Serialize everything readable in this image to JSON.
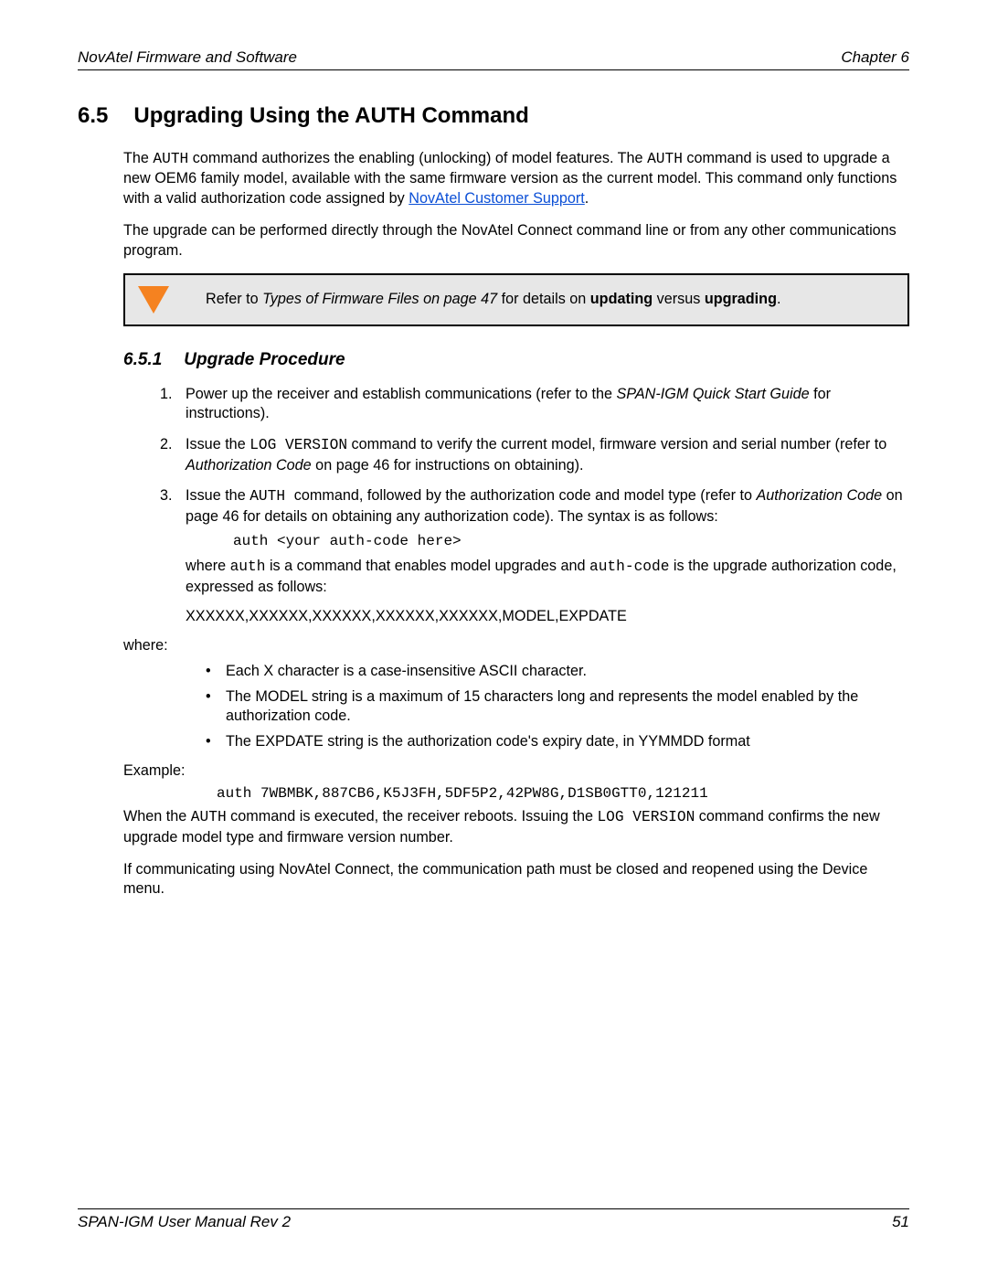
{
  "header": {
    "left": "NovAtel Firmware and Software",
    "right": "Chapter 6"
  },
  "section": {
    "number": "6.5",
    "title": "Upgrading Using the AUTH Command"
  },
  "intro": {
    "p1_a": "The ",
    "p1_code1": "AUTH",
    "p1_b": " command authorizes the enabling (unlocking) of model features. The ",
    "p1_code2": "AUTH",
    "p1_c": " command is used to upgrade a new OEM6 family model, available with the same firmware version as the current model. This command only functions with a valid authorization code assigned by ",
    "p1_link": "NovAtel Customer Support",
    "p1_d": ".",
    "p2": "The upgrade can be performed directly through the NovAtel Connect command line or from any other communications program."
  },
  "note": {
    "prefix": "Refer to ",
    "italic_ref": "Types of Firmware Files on page 47",
    "mid": " for details on ",
    "bold1": "updating",
    "vs": " versus ",
    "bold2": "upgrading",
    "suffix": "."
  },
  "subsection": {
    "number": "6.5.1",
    "title": "Upgrade Procedure"
  },
  "steps": {
    "s1_a": "Power up the receiver and establish communications (refer to the ",
    "s1_i": "SPAN-IGM Quick Start Guide",
    "s1_b": " for instructions).",
    "s2_a": "Issue the ",
    "s2_code": "LOG VERSION",
    "s2_b": " command to verify the current model, firmware version and serial number (refer to ",
    "s2_i": "Authorization Code",
    "s2_c": " on page 46 for instructions on obtaining).",
    "s3_a": "Issue the ",
    "s3_code": "AUTH ",
    "s3_b": " command, followed by the authorization code and model type (refer to ",
    "s3_i": "Authorization Code",
    "s3_c": " on page 46 for details on obtaining any authorization code). The syntax is as follows:",
    "s3_syntax": "auth <your auth-code here>",
    "s3_where_a": "where ",
    "s3_where_code1": "auth",
    "s3_where_b": " is a command that enables model upgrades and ",
    "s3_where_code2": "auth-code",
    "s3_where_c": " is the upgrade authorization code, expressed as follows:",
    "s3_pattern": "XXXXXX,XXXXXX,XXXXXX,XXXXXX,XXXXXX,MODEL,EXPDATE"
  },
  "where_label": "where:",
  "bullets": {
    "b1": "Each X character is a case-insensitive ASCII character.",
    "b2": "The MODEL string is a maximum of 15 characters long and represents the model enabled by the authorization code.",
    "b3": "The EXPDATE string is the authorization code's expiry date, in YYMMDD format"
  },
  "example_label": "Example:",
  "example_code": "auth 7WBMBK,887CB6,K5J3FH,5DF5P2,42PW8G,D1SB0GTT0,121211",
  "closing": {
    "p1_a": "When the ",
    "p1_code1": "AUTH",
    "p1_b": " command is executed, the receiver reboots. Issuing the ",
    "p1_code2": "LOG VERSION",
    "p1_c": " command confirms the new upgrade model type and firmware version number.",
    "p2": "If communicating using NovAtel Connect, the communication path must be closed and reopened using the Device menu."
  },
  "footer": {
    "left": "SPAN-IGM User Manual Rev 2",
    "right": "51"
  }
}
